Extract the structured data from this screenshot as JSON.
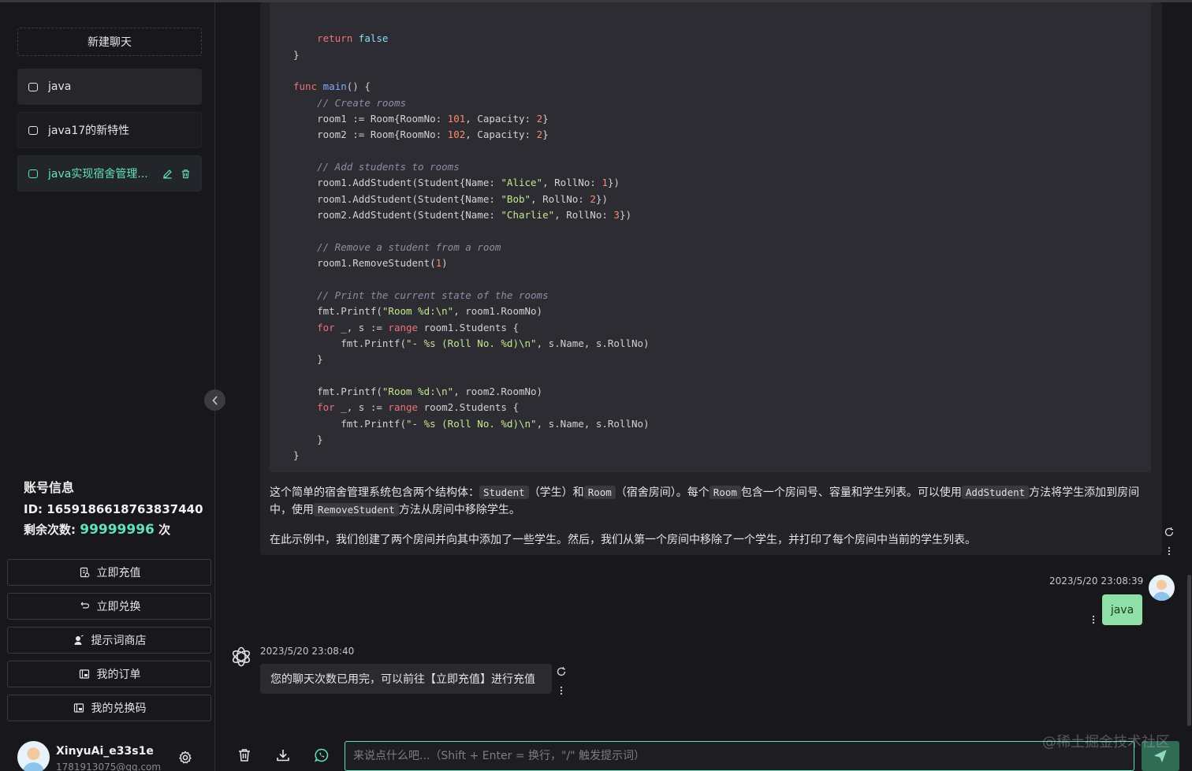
{
  "sidebar": {
    "new_chat_label": "新建聊天",
    "chats": [
      {
        "label": "java",
        "state": "hover"
      },
      {
        "label": "java17的新特性",
        "state": "normal"
      },
      {
        "label": "java实现宿舍管理...",
        "state": "active"
      }
    ],
    "account": {
      "title": "账号信息",
      "id_label": "ID: 1659186618763837440",
      "remaining_prefix": "剩余次数: ",
      "remaining_value": "99999996",
      "remaining_suffix": " 次"
    },
    "buttons": [
      {
        "label": "立即充值",
        "icon": "recharge-icon"
      },
      {
        "label": "立即兑换",
        "icon": "exchange-icon"
      },
      {
        "label": "提示词商店",
        "icon": "prompt-store-icon"
      },
      {
        "label": "我的订单",
        "icon": "order-icon"
      },
      {
        "label": "我的兑换码",
        "icon": "redeem-code-icon"
      }
    ],
    "user": {
      "name": "XinyuAi_e33s1e",
      "email": "1781913075@qq.com"
    }
  },
  "messages": {
    "code_lines": [
      "return false",
      "}",
      "",
      "func main() {",
      "// Create rooms",
      "room1 := Room{RoomNo: 101, Capacity: 2}",
      "room2 := Room{RoomNo: 102, Capacity: 2}",
      "",
      "// Add students to rooms",
      "room1.AddStudent(Student{Name: \"Alice\", RollNo: 1})",
      "room1.AddStudent(Student{Name: \"Bob\", RollNo: 2})",
      "room2.AddStudent(Student{Name: \"Charlie\", RollNo: 3})",
      "",
      "// Remove a student from a room",
      "room1.RemoveStudent(1)",
      "",
      "// Print the current state of the rooms",
      "fmt.Printf(\"Room %d:\\n\", room1.RoomNo)",
      "for _, s := range room1.Students {",
      "fmt.Printf(\"- %s (Roll No. %d)\\n\", s.Name, s.RollNo)",
      "}",
      "",
      "fmt.Printf(\"Room %d:\\n\", room2.RoomNo)",
      "for _, s := range room2.Students {",
      "fmt.Printf(\"- %s (Roll No. %d)\\n\", s.Name, s.RollNo)",
      "}",
      "}"
    ],
    "para1": {
      "t1": "这个简单的宿舍管理系统包含两个结构体：",
      "c1": "Student",
      "t2": "（学生）和",
      "c2": "Room",
      "t3": "（宿舍房间）。每个",
      "c3": "Room",
      "t4": "包含一个房间号、容量和学生列表。可以使用",
      "c4": "AddStudent",
      "t5": "方法将学生添加到房间中，使用",
      "c5": "RemoveStudent",
      "t6": "方法从房间中移除学生。"
    },
    "para2": "在此示例中，我们创建了两个房间并向其中添加了一些学生。然后，我们从第一个房间中移除了一个学生，并打印了每个房间中当前的学生列表。",
    "user_msg": {
      "time": "2023/5/20 23:08:39",
      "text": "java"
    },
    "bot_msg": {
      "time": "2023/5/20 23:08:40",
      "text": "您的聊天次数已用完，可以前往【立即充值】进行充值"
    }
  },
  "input": {
    "placeholder": "来说点什么吧...（Shift + Enter = 换行，\"/\" 触发提示词）"
  },
  "watermark": "@稀土掘金技术社区",
  "colors": {
    "accent": "#63e2b7",
    "user_bubble": "#8fe0a6",
    "bg": "#18181c"
  }
}
